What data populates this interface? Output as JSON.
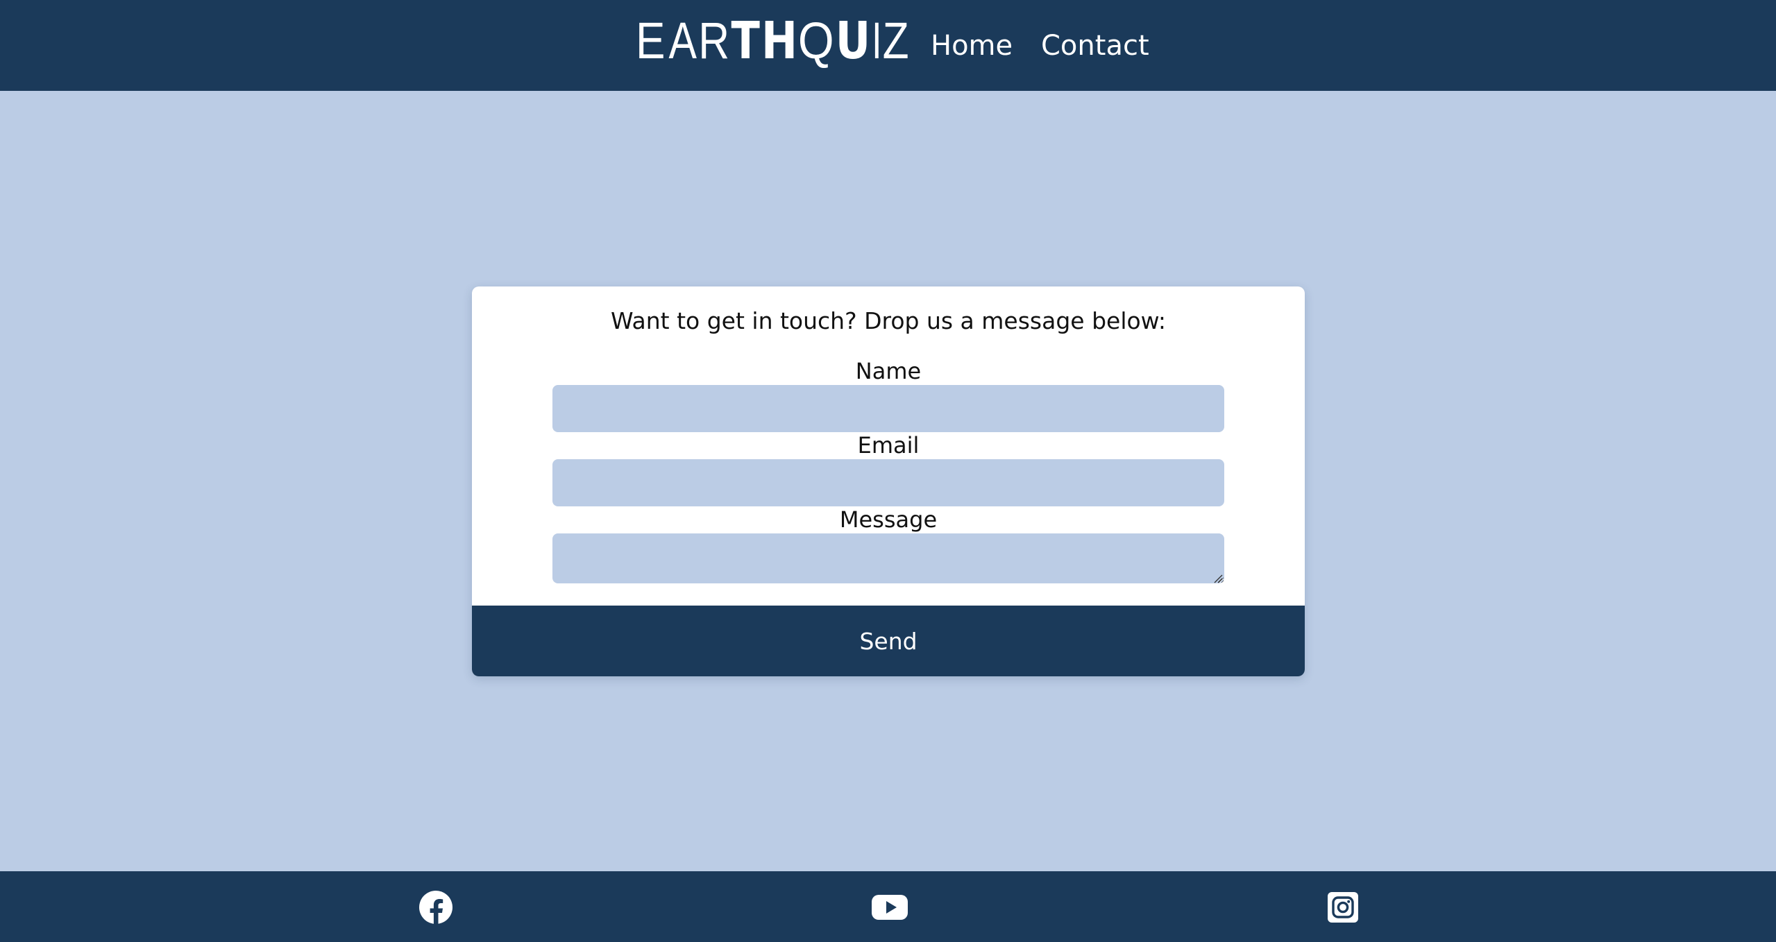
{
  "header": {
    "brand_letters": [
      "E",
      "A",
      "R",
      "T",
      "H",
      "Q",
      "U",
      "I",
      "Z"
    ],
    "nav": [
      {
        "label": "Home"
      },
      {
        "label": "Contact"
      }
    ]
  },
  "contact_form": {
    "intro": "Want to get in touch? Drop us a message below:",
    "fields": {
      "name": {
        "label": "Name",
        "value": ""
      },
      "email": {
        "label": "Email",
        "value": ""
      },
      "message": {
        "label": "Message",
        "value": ""
      }
    },
    "submit_label": "Send"
  },
  "footer": {
    "social_icons": [
      "facebook-icon",
      "youtube-icon",
      "instagram-icon"
    ]
  },
  "colors": {
    "header_bg": "#1b3a5a",
    "page_bg": "#bbcce5",
    "card_bg": "#ffffff",
    "input_bg": "#bbcce5",
    "button_bg": "#1b3a5a",
    "text": "#111111",
    "inverse_text": "#ffffff"
  }
}
